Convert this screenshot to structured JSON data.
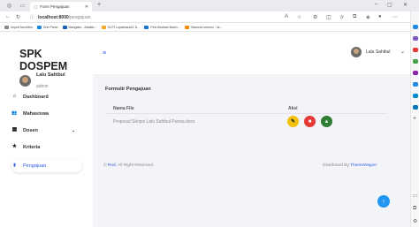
{
  "browser": {
    "tab_title": "Form Pengajuan",
    "url_host": "localhost:8000",
    "url_path": "/pengajuan",
    "bookmarks": [
      {
        "label": "Import favorites",
        "color": "#888888"
      },
      {
        "label": "One Piece",
        "color": "#1e88e5"
      },
      {
        "label": "Mangaku - Adalah...",
        "color": "#1565c0"
      },
      {
        "label": "GUTI Layarkaca21 D...",
        "color": "#f9a825"
      },
      {
        "label": "Pink Akshasi Basin...",
        "color": "#1976d2"
      },
      {
        "label": "Otaсuna shoenv - sk...",
        "color": "#fb8c00"
      }
    ]
  },
  "sidebar": {
    "brand": "SPK DOSPEM",
    "user_name": "Lalu Sahibul",
    "user_role": "admin",
    "items": [
      {
        "label": "Dashboard",
        "icon": "home-icon",
        "glyph": "⌂"
      },
      {
        "label": "Mahasiswa",
        "icon": "users-icon",
        "glyph": "👥"
      },
      {
        "label": "Dosen",
        "icon": "table-icon",
        "glyph": "▦",
        "chevron": "⌄"
      },
      {
        "label": "Kriteria",
        "icon": "star-icon",
        "glyph": "★"
      },
      {
        "label": "Pengajuan",
        "icon": "file-icon",
        "glyph": "▮",
        "active": true
      }
    ]
  },
  "topbar": {
    "menu_glyph": "≡",
    "user_name": "Lalu Sahibul",
    "chevron": "⌄"
  },
  "card": {
    "title": "Formulir Pengajuan",
    "columns": [
      "Nama File",
      "Aksi"
    ],
    "rows": [
      {
        "file": "Proposal Skripsi Lalu Sahibul Purwa.docx"
      }
    ],
    "actions": [
      {
        "name": "edit-icon",
        "color": "#f4c20d",
        "glyph": "✎"
      },
      {
        "name": "delete-icon",
        "color": "#e53935",
        "glyph": "■"
      },
      {
        "name": "upload-icon",
        "color": "#2e7d32",
        "glyph": "▲"
      }
    ]
  },
  "footer": {
    "left_prefix": "© ",
    "left_brand": "Rod.",
    "left_suffix": " All Right Reserved.",
    "right_prefix": "Distributed By ",
    "right_brand": "ThemeWagon"
  },
  "fab": {
    "glyph": "↑"
  },
  "colors": {
    "accent": "#2f5bea",
    "fab": "#2196f3"
  }
}
